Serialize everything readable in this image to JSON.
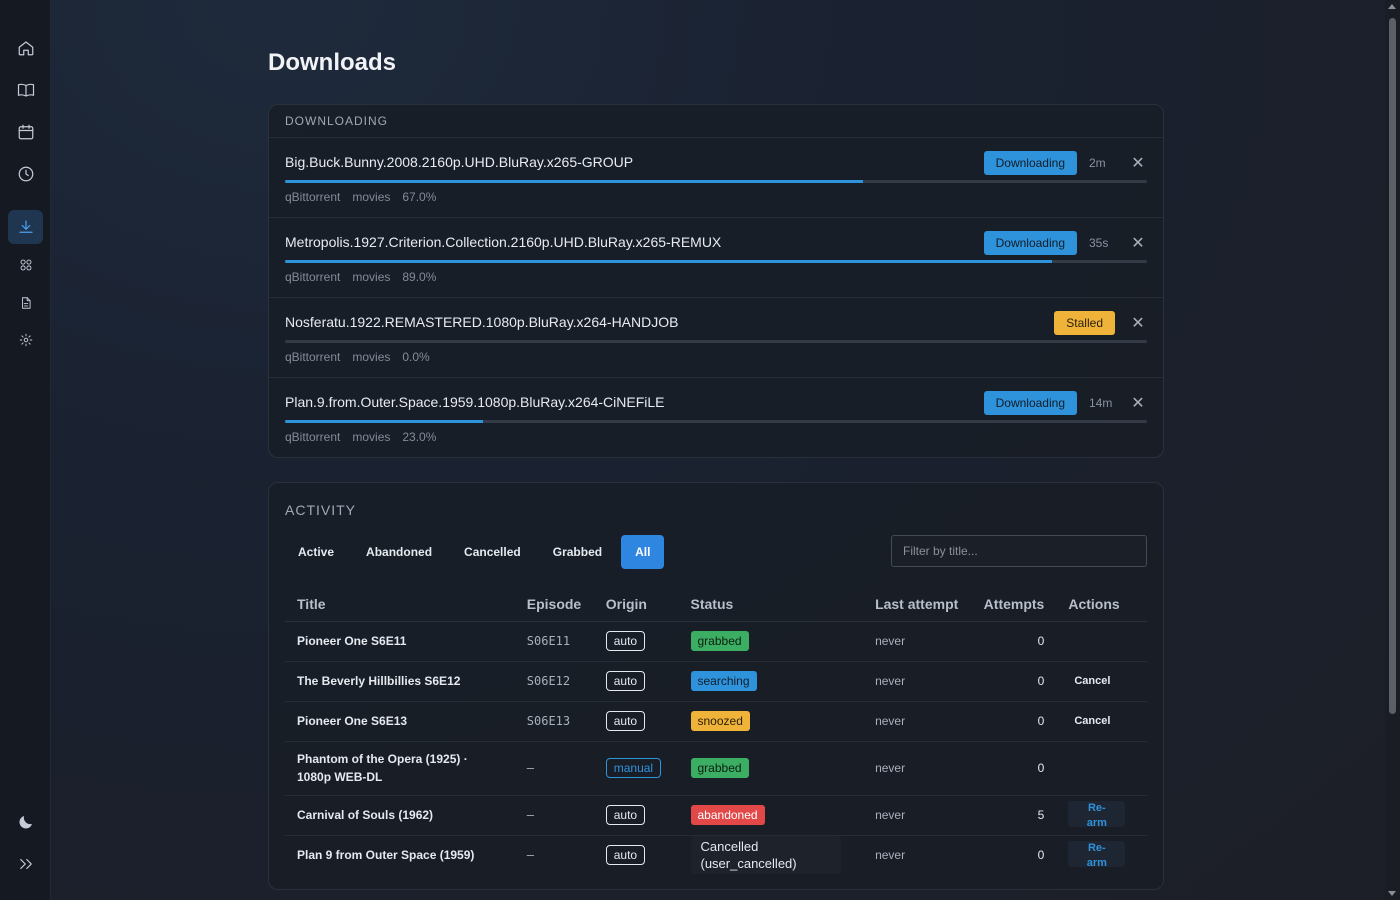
{
  "sidebar": {
    "icons": [
      "home-icon",
      "book-icon",
      "calendar-icon",
      "clock-icon",
      "download-icon",
      "apps-icon",
      "document-icon",
      "gear-icon",
      "moon-icon",
      "expand-icon"
    ],
    "active": "download-icon"
  },
  "page": {
    "title": "Downloads"
  },
  "downloads": {
    "section_title": "DOWNLOADING",
    "items": [
      {
        "name": "Big.Buck.Bunny.2008.2160p.UHD.BluRay.x265-GROUP",
        "status": "Downloading",
        "eta": "2m",
        "client": "qBittorrent",
        "category": "movies",
        "progress_label": "67.0%",
        "progress": 0.67
      },
      {
        "name": "Metropolis.1927.Criterion.Collection.2160p.UHD.BluRay.x265-REMUX",
        "status": "Downloading",
        "eta": "35s",
        "client": "qBittorrent",
        "category": "movies",
        "progress_label": "89.0%",
        "progress": 0.89
      },
      {
        "name": "Nosferatu.1922.REMASTERED.1080p.BluRay.x264-HANDJOB",
        "status": "Stalled",
        "eta": "",
        "client": "qBittorrent",
        "category": "movies",
        "progress_label": "0.0%",
        "progress": 0.0
      },
      {
        "name": "Plan.9.from.Outer.Space.1959.1080p.BluRay.x264-CiNEFiLE",
        "status": "Downloading",
        "eta": "14m",
        "client": "qBittorrent",
        "category": "movies",
        "progress_label": "23.0%",
        "progress": 0.23
      }
    ],
    "close_glyph": "✕"
  },
  "activity": {
    "section_title": "ACTIVITY",
    "tabs": [
      "Active",
      "Abandoned",
      "Cancelled",
      "Grabbed",
      "All"
    ],
    "active_tab": "All",
    "filter_placeholder": "Filter by title...",
    "columns": [
      "Title",
      "Episode",
      "Origin",
      "Status",
      "Last attempt",
      "Attempts",
      "Actions"
    ],
    "rows": [
      {
        "title": "Pioneer One S6E11",
        "episode": "S06E11",
        "origin": "auto",
        "status": "grabbed",
        "last_attempt": "never",
        "attempts": "0",
        "action": ""
      },
      {
        "title": "The Beverly Hillbillies S6E12",
        "episode": "S06E12",
        "origin": "auto",
        "status": "searching",
        "last_attempt": "never",
        "attempts": "0",
        "action": "Cancel"
      },
      {
        "title": "Pioneer One S6E13",
        "episode": "S06E13",
        "origin": "auto",
        "status": "snoozed",
        "last_attempt": "never",
        "attempts": "0",
        "action": "Cancel"
      },
      {
        "title": "Phantom of the Opera (1925) · 1080p WEB-DL",
        "episode": "—",
        "origin": "manual",
        "status": "grabbed",
        "last_attempt": "never",
        "attempts": "0",
        "action": ""
      },
      {
        "title": "Carnival of Souls (1962)",
        "episode": "—",
        "origin": "auto",
        "status": "abandoned",
        "last_attempt": "never",
        "attempts": "5",
        "action": "Re-arm"
      },
      {
        "title": "Plan 9 from Outer Space (1959)",
        "episode": "—",
        "origin": "auto",
        "status": "Cancelled (user_cancelled)",
        "last_attempt": "never",
        "attempts": "0",
        "action": "Re-arm"
      }
    ],
    "rearm_parts": [
      "Re-",
      "arm"
    ]
  },
  "colors": {
    "accent": "#2f93dc",
    "stalled": "#f0b33a",
    "grabbed": "#3cae63",
    "abandoned": "#e34848"
  }
}
